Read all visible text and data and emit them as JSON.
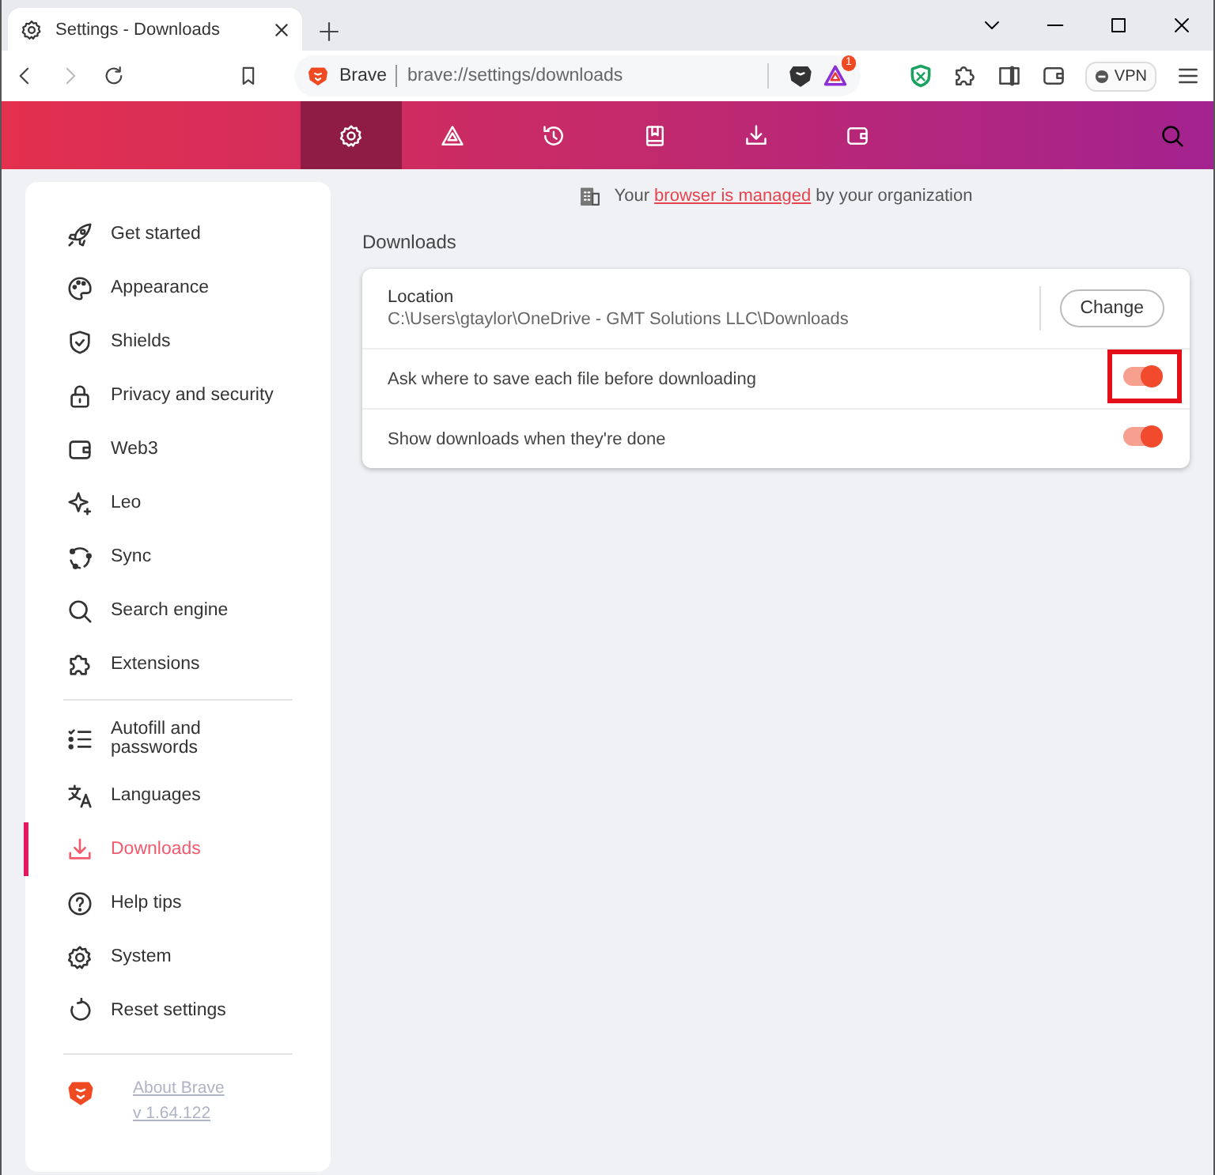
{
  "window": {
    "tab_title": "Settings - Downloads"
  },
  "toolbar": {
    "back_disabled": false,
    "forward_disabled": true,
    "site_label": "Brave",
    "url": "brave://settings/downloads",
    "rewards_badge": "1",
    "vpn_label": "VPN"
  },
  "header_nav": [
    {
      "selected": true
    },
    {
      "selected": false
    },
    {
      "selected": false
    },
    {
      "selected": false
    },
    {
      "selected": false
    },
    {
      "selected": false
    }
  ],
  "sidebar": {
    "items": [
      {
        "label": "Get started",
        "selected": false,
        "divider_before": false
      },
      {
        "label": "Appearance",
        "selected": false,
        "divider_before": false
      },
      {
        "label": "Shields",
        "selected": false,
        "divider_before": false
      },
      {
        "label": "Privacy and security",
        "selected": false,
        "divider_before": false
      },
      {
        "label": "Web3",
        "selected": false,
        "divider_before": false
      },
      {
        "label": "Leo",
        "selected": false,
        "divider_before": false
      },
      {
        "label": "Sync",
        "selected": false,
        "divider_before": false
      },
      {
        "label": "Search engine",
        "selected": false,
        "divider_before": false
      },
      {
        "label": "Extensions",
        "selected": false,
        "divider_before": false
      },
      {
        "label": "Autofill and passwords",
        "selected": false,
        "divider_before": true
      },
      {
        "label": "Languages",
        "selected": false,
        "divider_before": false
      },
      {
        "label": "Downloads",
        "selected": true,
        "divider_before": false
      },
      {
        "label": "Help tips",
        "selected": false,
        "divider_before": false
      },
      {
        "label": "System",
        "selected": false,
        "divider_before": false
      },
      {
        "label": "Reset settings",
        "selected": false,
        "divider_before": false
      }
    ],
    "about_link": "About Brave",
    "version": "v 1.64.122"
  },
  "managed_notice": {
    "before": "Your",
    "link": "browser is managed",
    "after": "by your organization"
  },
  "section_title": "Downloads",
  "location": {
    "label": "Location",
    "path": "C:\\Users\\gtaylor\\OneDrive - GMT Solutions LLC\\Downloads",
    "button": "Change"
  },
  "toggles": [
    {
      "label": "Ask where to save each file before downloading",
      "on": true,
      "highlighted": true
    },
    {
      "label": "Show downloads when they're done",
      "on": true,
      "highlighted": false
    }
  ]
}
